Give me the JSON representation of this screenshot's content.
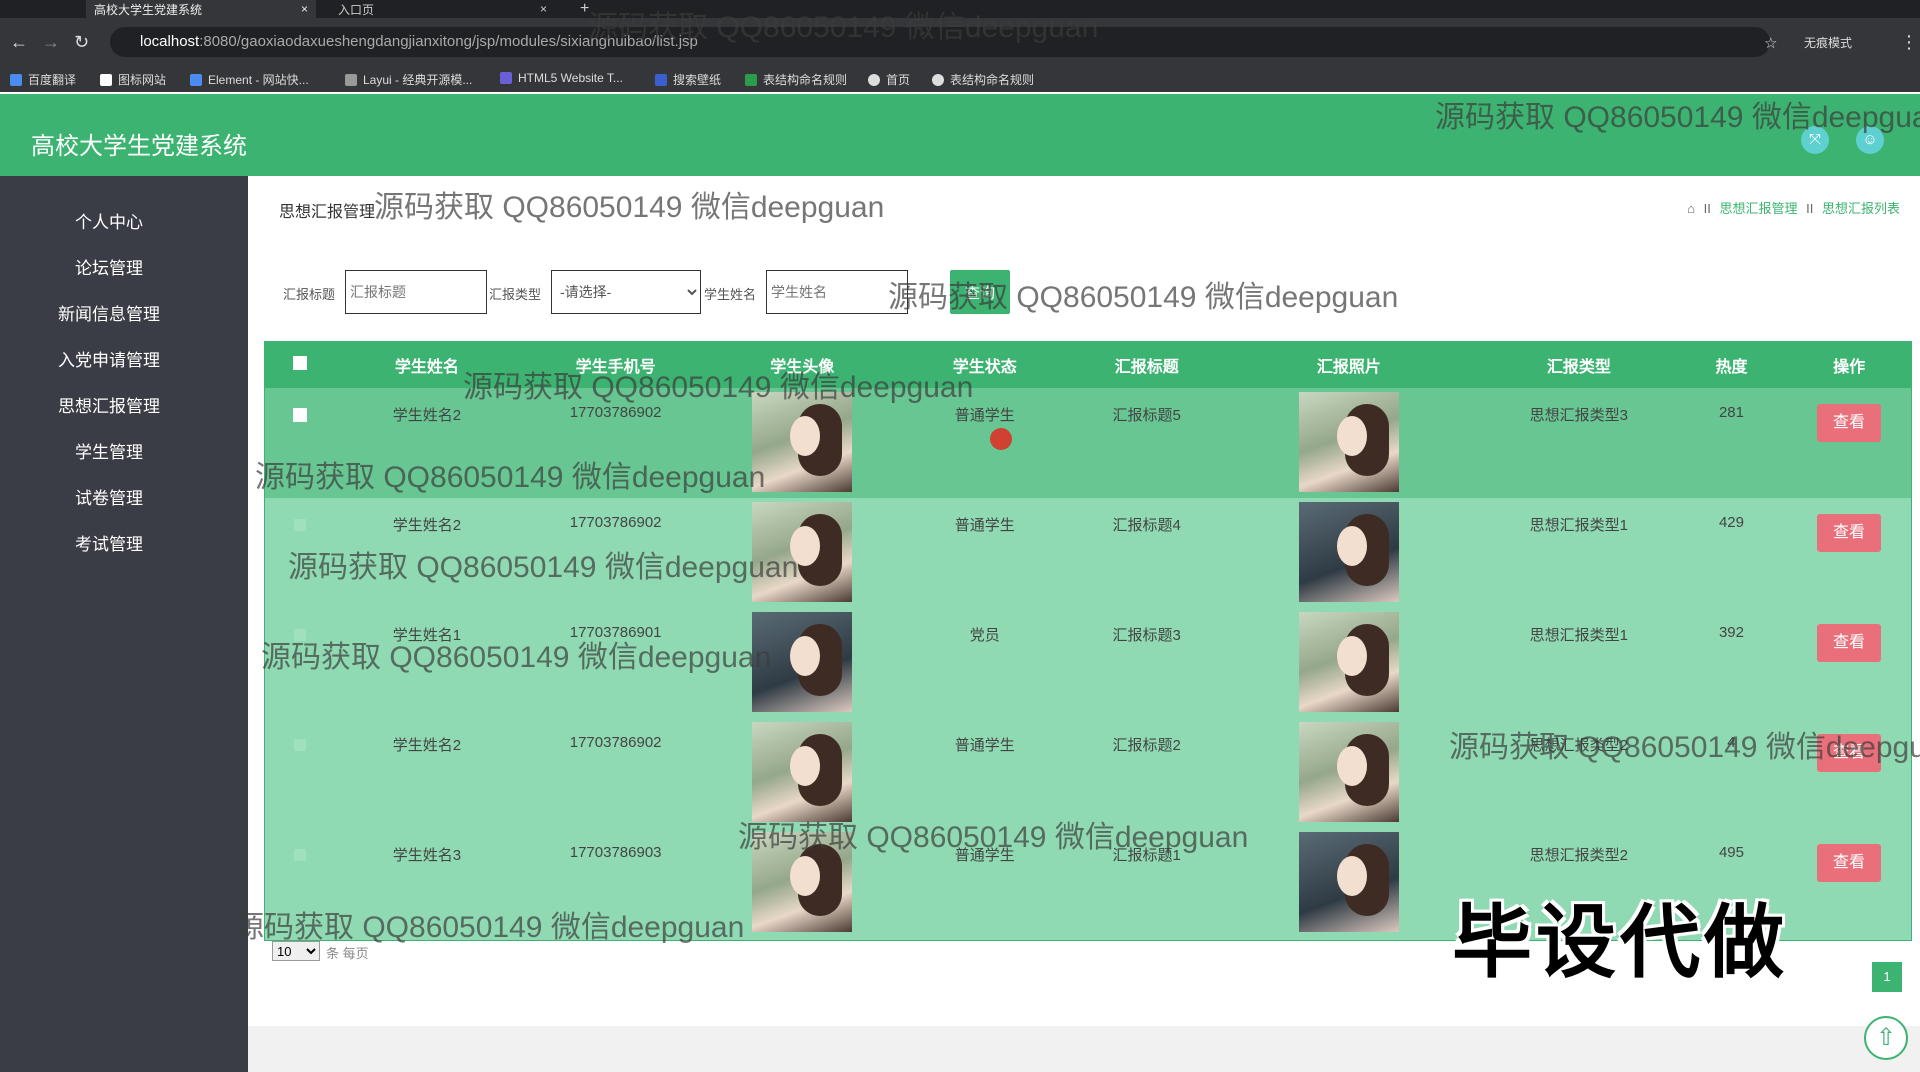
{
  "browser": {
    "tabs": [
      {
        "label": "高校大学生党建系统",
        "close": "×"
      },
      {
        "label": "入口页",
        "close": "×"
      }
    ],
    "new_tab": "+",
    "url_host": "localhost",
    "url_path": ":8080/gaoxiaodaxueshengdangjianxitong/jsp/modules/sixianghuibao/list.jsp",
    "profile_label": "无痕模式",
    "bookmarks": [
      "百度翻译",
      "图标网站",
      "Element - 网站快...",
      "Layui - 经典开源模...",
      "HTML5 Website T...",
      "搜索壁纸",
      "表结构命名规则",
      "首页",
      "表结构命名规则"
    ]
  },
  "app": {
    "title": "高校大学生党建系统"
  },
  "sidebar": {
    "items": [
      {
        "label": "个人中心"
      },
      {
        "label": "论坛管理"
      },
      {
        "label": "新闻信息管理"
      },
      {
        "label": "入党申请管理"
      },
      {
        "label": "思想汇报管理"
      },
      {
        "label": "学生管理"
      },
      {
        "label": "试卷管理"
      },
      {
        "label": "考试管理"
      }
    ]
  },
  "page": {
    "title": "思想汇报管理",
    "breadcrumb": [
      "思想汇报管理",
      "思想汇报列表"
    ],
    "breadcrumb_sep": "II"
  },
  "search": {
    "title_label": "汇报标题",
    "title_placeholder": "汇报标题",
    "type_label": "汇报类型",
    "type_selected": "-请选择-",
    "name_label": "学生姓名",
    "name_placeholder": "学生姓名",
    "button_label": "查询"
  },
  "table": {
    "columns": [
      "学生姓名",
      "学生手机号",
      "学生头像",
      "学生状态",
      "汇报标题",
      "汇报照片",
      "汇报类型",
      "热度",
      "操作"
    ],
    "rows": [
      {
        "name": "学生姓名2",
        "phone": "17703786902",
        "status": "普通学生",
        "title": "汇报标题5",
        "type": "思想汇报类型3",
        "heat": "281",
        "action": "查看"
      },
      {
        "name": "学生姓名2",
        "phone": "17703786902",
        "status": "普通学生",
        "title": "汇报标题4",
        "type": "思想汇报类型1",
        "heat": "429",
        "action": "查看"
      },
      {
        "name": "学生姓名1",
        "phone": "17703786901",
        "status": "党员",
        "title": "汇报标题3",
        "type": "思想汇报类型1",
        "heat": "392",
        "action": "查看"
      },
      {
        "name": "学生姓名2",
        "phone": "17703786902",
        "status": "普通学生",
        "title": "汇报标题2",
        "type": "思想汇报类型2",
        "heat": "4",
        "action": "查看"
      },
      {
        "name": "学生姓名3",
        "phone": "17703786903",
        "status": "普通学生",
        "title": "汇报标题1",
        "type": "思想汇报类型2",
        "heat": "495",
        "action": "查看"
      }
    ]
  },
  "pager": {
    "page_size": "10",
    "per_page_label": "条 每页",
    "current_page": "1"
  },
  "overlays": {
    "watermark": "源码获取 QQ86050149 微信deepguan",
    "stamp": "毕设代做"
  },
  "colors": {
    "primary": "#3cb371",
    "sidebar": "#3a3d45",
    "view_button": "#e9707a"
  }
}
